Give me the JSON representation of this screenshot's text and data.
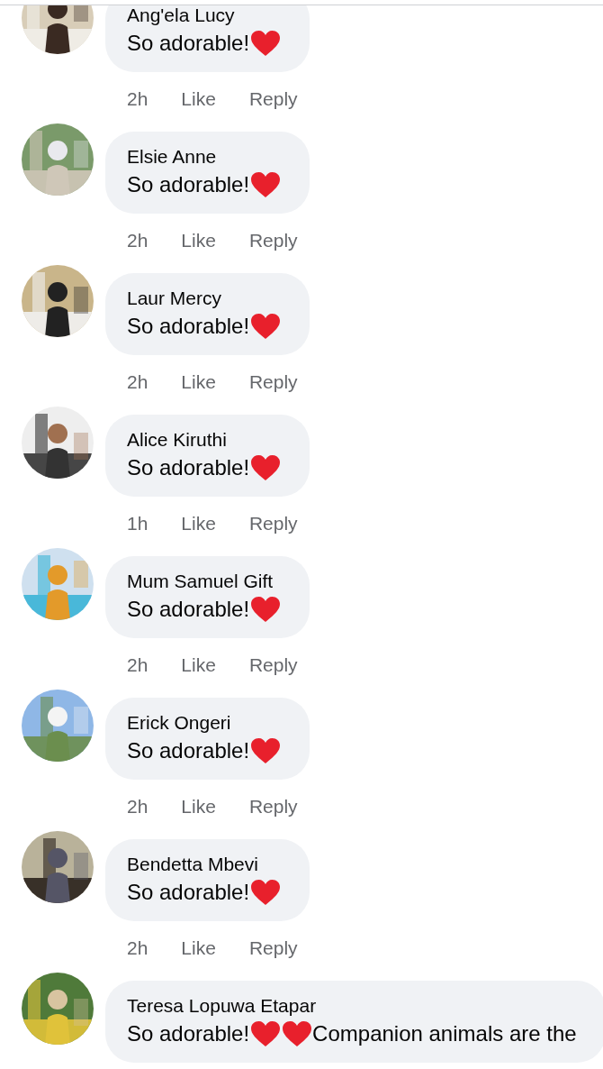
{
  "comments": [
    {
      "author": "Ang'ela Lucy",
      "body": [
        {
          "kind": "text",
          "text": "So adorable!"
        },
        {
          "kind": "heart"
        }
      ],
      "time": "2h",
      "actions": [
        "Like",
        "Reply"
      ]
    },
    {
      "author": "Elsie Anne",
      "body": [
        {
          "kind": "text",
          "text": "So adorable!"
        },
        {
          "kind": "heart"
        }
      ],
      "time": "2h",
      "actions": [
        "Like",
        "Reply"
      ]
    },
    {
      "author": "Laur Mercy",
      "body": [
        {
          "kind": "text",
          "text": "So adorable!"
        },
        {
          "kind": "heart"
        }
      ],
      "time": "2h",
      "actions": [
        "Like",
        "Reply"
      ]
    },
    {
      "author": "Alice Kiruthi",
      "body": [
        {
          "kind": "text",
          "text": "So adorable!"
        },
        {
          "kind": "heart"
        }
      ],
      "time": "1h",
      "actions": [
        "Like",
        "Reply"
      ]
    },
    {
      "author": "Mum Samuel Gift",
      "body": [
        {
          "kind": "text",
          "text": "So adorable!"
        },
        {
          "kind": "heart"
        }
      ],
      "time": "2h",
      "actions": [
        "Like",
        "Reply"
      ]
    },
    {
      "author": "Erick Ongeri",
      "body": [
        {
          "kind": "text",
          "text": "So adorable!"
        },
        {
          "kind": "heart"
        }
      ],
      "time": "2h",
      "actions": [
        "Like",
        "Reply"
      ]
    },
    {
      "author": "Bendetta Mbevi",
      "body": [
        {
          "kind": "text",
          "text": "So adorable!"
        },
        {
          "kind": "heart"
        }
      ],
      "time": "2h",
      "actions": [
        "Like",
        "Reply"
      ]
    },
    {
      "author": "Teresa Lopuwa Etapar",
      "body": [
        {
          "kind": "text",
          "text": "So adorable!"
        },
        {
          "kind": "heart"
        },
        {
          "kind": "heart"
        },
        {
          "kind": "text",
          "text": "Companion animals are the"
        }
      ]
    }
  ]
}
